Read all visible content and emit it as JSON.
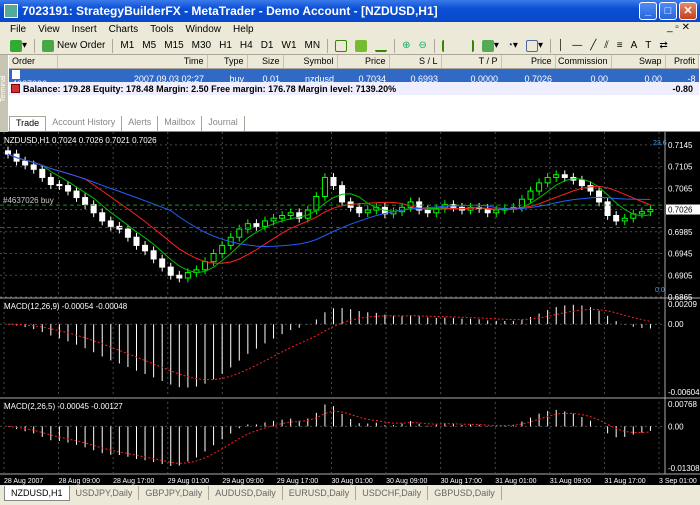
{
  "window": {
    "title": "7023191: StrategyBuilderFX - MetaTrader - Demo Account - [NZDUSD,H1]"
  },
  "menu": [
    "File",
    "View",
    "Insert",
    "Charts",
    "Tools",
    "Window",
    "Help"
  ],
  "toolbar": {
    "new_order": "New Order",
    "timeframes": [
      "M1",
      "M5",
      "M15",
      "M30",
      "H1",
      "H4",
      "D1",
      "W1",
      "MN"
    ]
  },
  "terminal": {
    "side_label": "Terminal",
    "columns": [
      "Order",
      "Time",
      "Type",
      "Size",
      "Symbol",
      "Price",
      "S / L",
      "T / P",
      "Price",
      "Commission",
      "Swap",
      "Profit"
    ],
    "order": {
      "id": "4637026",
      "time": "2007.09.03 02:27",
      "type": "buy",
      "size": "0.01",
      "symbol": "nzdusd",
      "price": "0.7034",
      "sl": "0.6993",
      "tp": "0.0000",
      "current_price": "0.7026",
      "commission": "0.00",
      "swap": "0.00",
      "profit": "-8"
    },
    "balance_line": "Balance: 179.28  Equity: 178.48  Margin: 2.50  Free margin: 176.78  Margin level: 7139.20%",
    "total_profit": "-0.80",
    "tabs": [
      "Trade",
      "Account History",
      "Alerts",
      "Mailbox",
      "Journal"
    ]
  },
  "chart_data": {
    "type": "line",
    "title": "NZDUSD,H1  0.7024 0.7026 0.7021 0.7026",
    "order_label": "#4637026 buy",
    "price_axis": [
      "0.7145",
      "0.7105",
      "0.7065",
      "0.7026",
      "0.6985",
      "0.6945",
      "0.6905",
      "0.6865"
    ],
    "current_price": "0.7026",
    "level_labels": [
      "0.0",
      "23.6"
    ],
    "macd1": {
      "label": "MACD(12,26,9) -0.00054 -0.00048",
      "axis": [
        "0.00209",
        "0.00",
        "-0.00604"
      ]
    },
    "macd2": {
      "label": "MACD(2,26,5) -0.00045 -0.00127",
      "axis": [
        "0.00768",
        "0.00",
        "-0.01308"
      ]
    },
    "time_axis": [
      "28 Aug 2007",
      "28 Aug 09:00",
      "28 Aug 17:00",
      "29 Aug 01:00",
      "29 Aug 09:00",
      "29 Aug 17:00",
      "30 Aug 01:00",
      "30 Aug 09:00",
      "30 Aug 17:00",
      "31 Aug 01:00",
      "31 Aug 09:00",
      "31 Aug 17:00",
      "3 Sep 01:00"
    ],
    "closes": [
      0.7128,
      0.7115,
      0.7108,
      0.71,
      0.7085,
      0.7072,
      0.707,
      0.706,
      0.7048,
      0.7035,
      0.702,
      0.7005,
      0.6995,
      0.699,
      0.6975,
      0.696,
      0.695,
      0.6935,
      0.692,
      0.6905,
      0.69,
      0.691,
      0.6915,
      0.693,
      0.6945,
      0.696,
      0.6975,
      0.699,
      0.7,
      0.6995,
      0.7005,
      0.701,
      0.7015,
      0.702,
      0.701,
      0.7025,
      0.705,
      0.7085,
      0.707,
      0.704,
      0.703,
      0.702,
      0.7025,
      0.703,
      0.7018,
      0.7022,
      0.703,
      0.704,
      0.7025,
      0.702,
      0.7028,
      0.7035,
      0.703,
      0.7025,
      0.703,
      0.7028,
      0.702,
      0.7025,
      0.7028,
      0.703,
      0.7045,
      0.706,
      0.7075,
      0.7085,
      0.709,
      0.7085,
      0.708,
      0.707,
      0.706,
      0.704,
      0.7015,
      0.7005,
      0.701,
      0.7018,
      0.7022,
      0.7026
    ],
    "colors": {
      "bull": "#00ff00",
      "bear": "#ffffff",
      "ma_fast": "#00c000",
      "ma_slow": "#ff2020",
      "ma_long": "#2060ff",
      "grid": "#4a4a4a",
      "macd_signal": "#ff2020"
    }
  },
  "bottom_tabs": [
    "NZDUSD,H1",
    "USDJPY,Daily",
    "GBPJPY,Daily",
    "AUDUSD,Daily",
    "EURUSD,Daily",
    "USDCHF,Daily",
    "GBPUSD,Daily"
  ]
}
